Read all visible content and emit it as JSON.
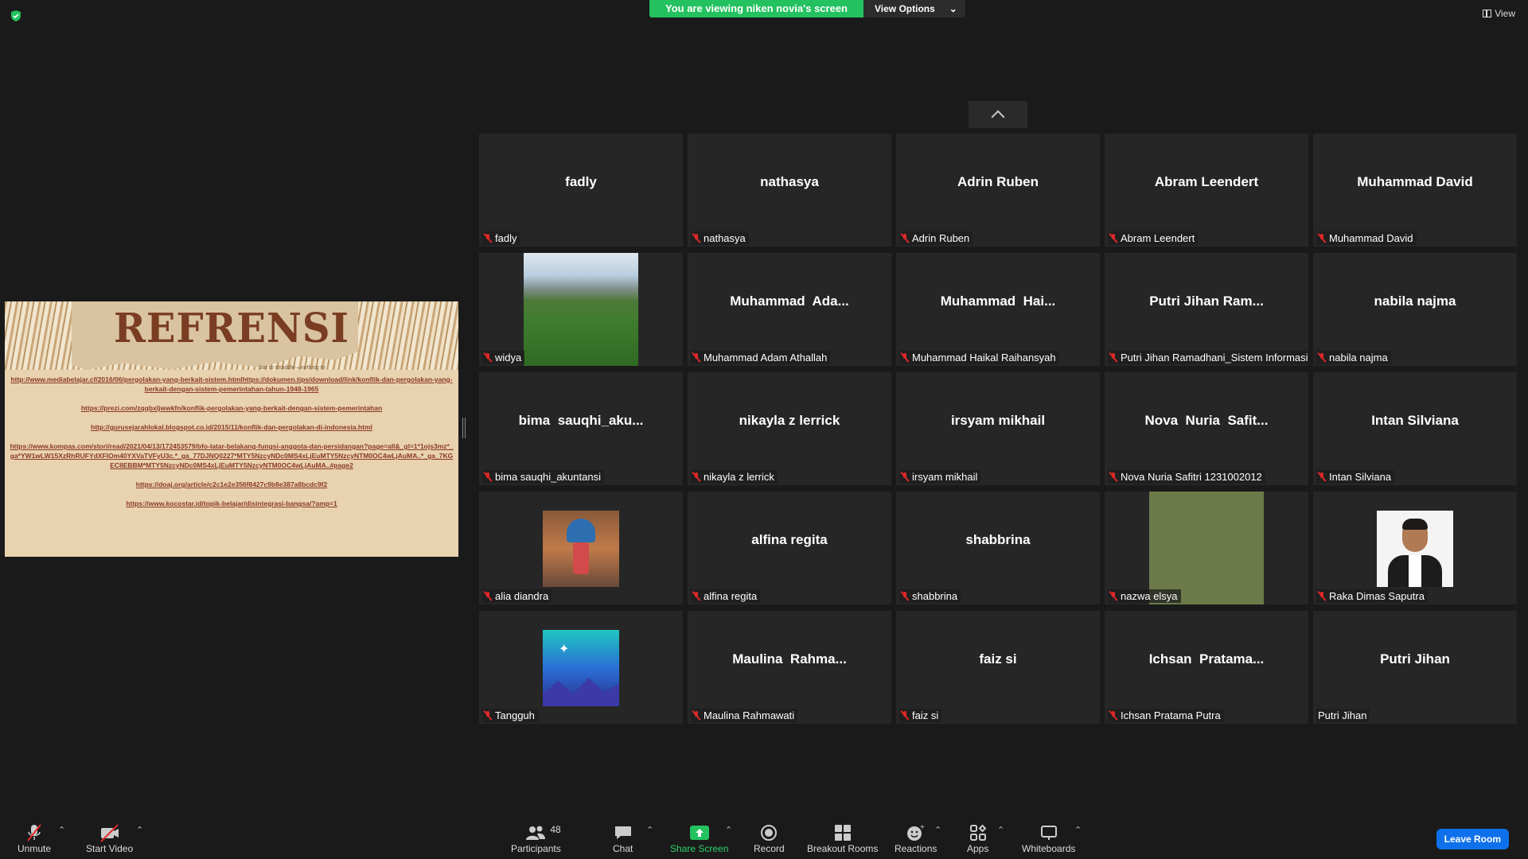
{
  "banner": {
    "viewing": "You are viewing niken novia's screen",
    "view_options": "View Options"
  },
  "view_button": "View",
  "share": {
    "title": "REFRENSI",
    "small_text": "bar to straddle—nothing to",
    "refs": [
      "http://www.mediabelajar.cf/2016/06/pergolakan-yang-berkait-sistem.htmlhttps://dokumen.tips/download/link/konflik-dan-pergolakan-yang-berkait-dengan-sistem-pemerintahan-tahun-1948-1965",
      "https://prezi.com/zqqbxljwwkfn/konflik-pergolakan-yang-berkait-dengan-sistem-pemerintahan",
      "http://gurusejarahlokal.blogspot.co.id/2015/11/konflik-dan-pergolakan-di-indonesia.html",
      "https://www.kompas.com/stori/read/2021/04/13/172453579/bfo-latar-belakang-fungsi-anggota-dan-persidangan?page=all&_gl=1*1ojs3mz*_ga*YW1wLW15XzRhRUFYdXFIOm40YXVaTVFyU3c.*_ga_77DJNQ0227*MTY5NzcyNDc0MS4xLjEuMTY5NzcyNTM0OC4wLjAuMA..*_ga_7KGEC8EBBM*MTY5NzcyNDc0MS4xLjEuMTY5NzcyNTM0OC4wLjAuMA..#page2",
      "https://doaj.org/article/c2c1e2e356f8427c9b8e387a8bcdc9f2",
      "https://www.kocostar.id/topik-belajar/disintegrasi-bangsa/?amp=1"
    ]
  },
  "participants": [
    {
      "tile": "fadly",
      "label": "fadly",
      "muted": true
    },
    {
      "tile": "nathasya",
      "label": "nathasya",
      "muted": true
    },
    {
      "tile": "Adrin Ruben",
      "label": "Adrin Ruben",
      "muted": true
    },
    {
      "tile": "Abram Leendert",
      "label": "Abram Leendert",
      "muted": true
    },
    {
      "tile": "Muhammad David",
      "label": "Muhammad David",
      "muted": true
    },
    {
      "tile": "",
      "label": "widya",
      "muted": true,
      "picture": "landscape-photo"
    },
    {
      "tile": "Muhammad  Ada...",
      "label": "Muhammad Adam Athallah",
      "muted": true
    },
    {
      "tile": "Muhammad  Hai...",
      "label": "Muhammad Haikal Raihansyah",
      "muted": true
    },
    {
      "tile": "Putri Jihan Ram...",
      "label": "Putri Jihan Ramadhani_Sistem Informasi",
      "muted": true
    },
    {
      "tile": "nabila najma",
      "label": "nabila najma",
      "muted": true
    },
    {
      "tile": "bima  sauqhi_aku...",
      "label": "bima sauqhi_akuntansi",
      "muted": true
    },
    {
      "tile": "nikayla z lerrick",
      "label": "nikayla z lerrick",
      "muted": true
    },
    {
      "tile": "irsyam mikhail",
      "label": "irsyam mikhail",
      "muted": true
    },
    {
      "tile": "Nova  Nuria  Safit...",
      "label": "Nova Nuria Safitri 1231002012",
      "muted": true
    },
    {
      "tile": "Intan Silviana",
      "label": "Intan Silviana",
      "muted": true
    },
    {
      "tile": "",
      "label": "alia diandra",
      "muted": true,
      "picture": "avatar-helmet"
    },
    {
      "tile": "alfina regita",
      "label": "alfina regita",
      "muted": true
    },
    {
      "tile": "shabbrina",
      "label": "shabbrina",
      "muted": true
    },
    {
      "tile": "",
      "label": "nazwa elsya",
      "muted": true,
      "picture": "green-block"
    },
    {
      "tile": "",
      "label": "Raka Dimas Saputra",
      "muted": true,
      "picture": "person-photo"
    },
    {
      "tile": "",
      "label": "Tangguh",
      "muted": true,
      "picture": "night-illustration"
    },
    {
      "tile": "Maulina  Rahma...",
      "label": "Maulina Rahmawati",
      "muted": true
    },
    {
      "tile": "faiz si",
      "label": "faiz si",
      "muted": true
    },
    {
      "tile": "Ichsan  Pratama...",
      "label": "Ichsan Pratama Putra",
      "muted": true
    },
    {
      "tile": "Putri Jihan",
      "label": "Putri Jihan",
      "muted": false
    }
  ],
  "toolbar": {
    "unmute": "Unmute",
    "start_video": "Start Video",
    "participants": "Participants",
    "participants_count": "48",
    "chat": "Chat",
    "share_screen": "Share Screen",
    "record": "Record",
    "breakout_rooms": "Breakout Rooms",
    "reactions": "Reactions",
    "apps": "Apps",
    "whiteboards": "Whiteboards",
    "leave": "Leave Room"
  },
  "colors": {
    "share_green": "#23c15f",
    "leave_blue": "#0e71eb",
    "muted_red": "#e02828"
  }
}
